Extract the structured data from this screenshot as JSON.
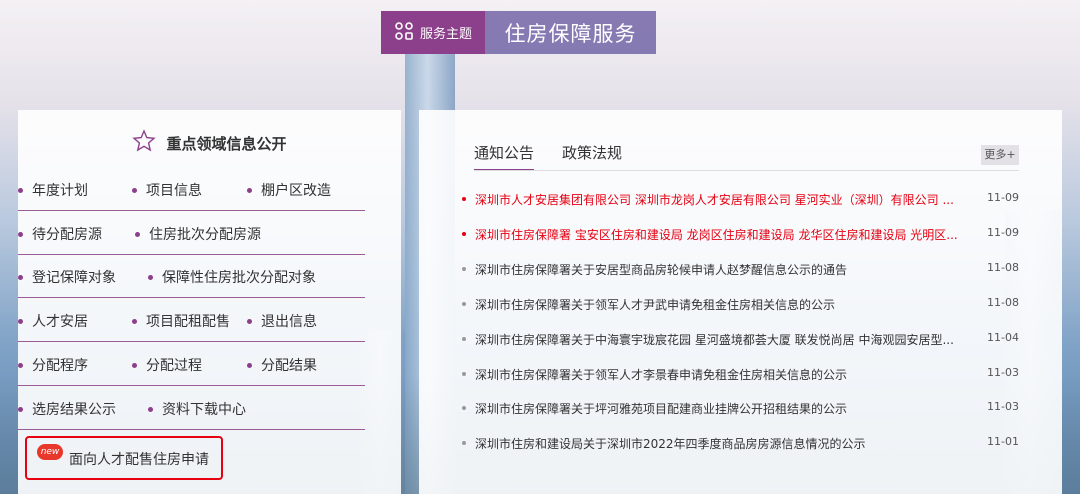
{
  "theme": {
    "tag_label": "服务主题",
    "title": "住房保障服务",
    "icon": "grid-icon"
  },
  "left": {
    "heading": "重点领域信息公开",
    "heading_icon": "star-icon",
    "rows": [
      [
        "年度计划",
        "项目信息",
        "棚户区改造"
      ],
      [
        "待分配房源",
        "住房批次分配房源"
      ],
      [
        "登记保障对象",
        "保障性住房批次分配对象"
      ],
      [
        "人才安居",
        "项目配租配售",
        "退出信息"
      ],
      [
        "分配程序",
        "分配过程",
        "分配结果"
      ],
      [
        "选房结果公示",
        "资料下载中心"
      ]
    ],
    "special": {
      "badge": "new",
      "label": "面向人才配售住房申请"
    }
  },
  "right": {
    "tabs": [
      "通知公告",
      "政策法规"
    ],
    "more": "更多+",
    "news": [
      {
        "text": "深圳市人才安居集团有限公司 深圳市龙岗人才安居有限公司 星河实业（深圳）有限公司 ...",
        "date": "11-09",
        "hot": true
      },
      {
        "text": "深圳市住房保障署 宝安区住房和建设局 龙岗区住房和建设局 龙华区住房和建设局 光明区...",
        "date": "11-09",
        "hot": true
      },
      {
        "text": "深圳市住房保障署关于安居型商品房轮候申请人赵梦醒信息公示的通告",
        "date": "11-08",
        "hot": false
      },
      {
        "text": "深圳市住房保障署关于领军人才尹武申请免租金住房相关信息的公示",
        "date": "11-08",
        "hot": false
      },
      {
        "text": "深圳市住房保障署关于中海寰宇珑宸花园 星河盛境都荟大厦 联发悦尚居 中海观园安居型...",
        "date": "11-04",
        "hot": false
      },
      {
        "text": "深圳市住房保障署关于领军人才李景春申请免租金住房相关信息的公示",
        "date": "11-03",
        "hot": false
      },
      {
        "text": "深圳市住房保障署关于坪河雅苑项目配建商业挂牌公开招租结果的公示",
        "date": "11-03",
        "hot": false
      },
      {
        "text": "深圳市住房和建设局关于深圳市2022年四季度商品房房源信息情况的公示",
        "date": "11-01",
        "hot": false
      }
    ]
  },
  "colors": {
    "accent": "#8c3f8a",
    "theme_title_bg": "#786aaa",
    "highlight_red": "#e60012"
  }
}
